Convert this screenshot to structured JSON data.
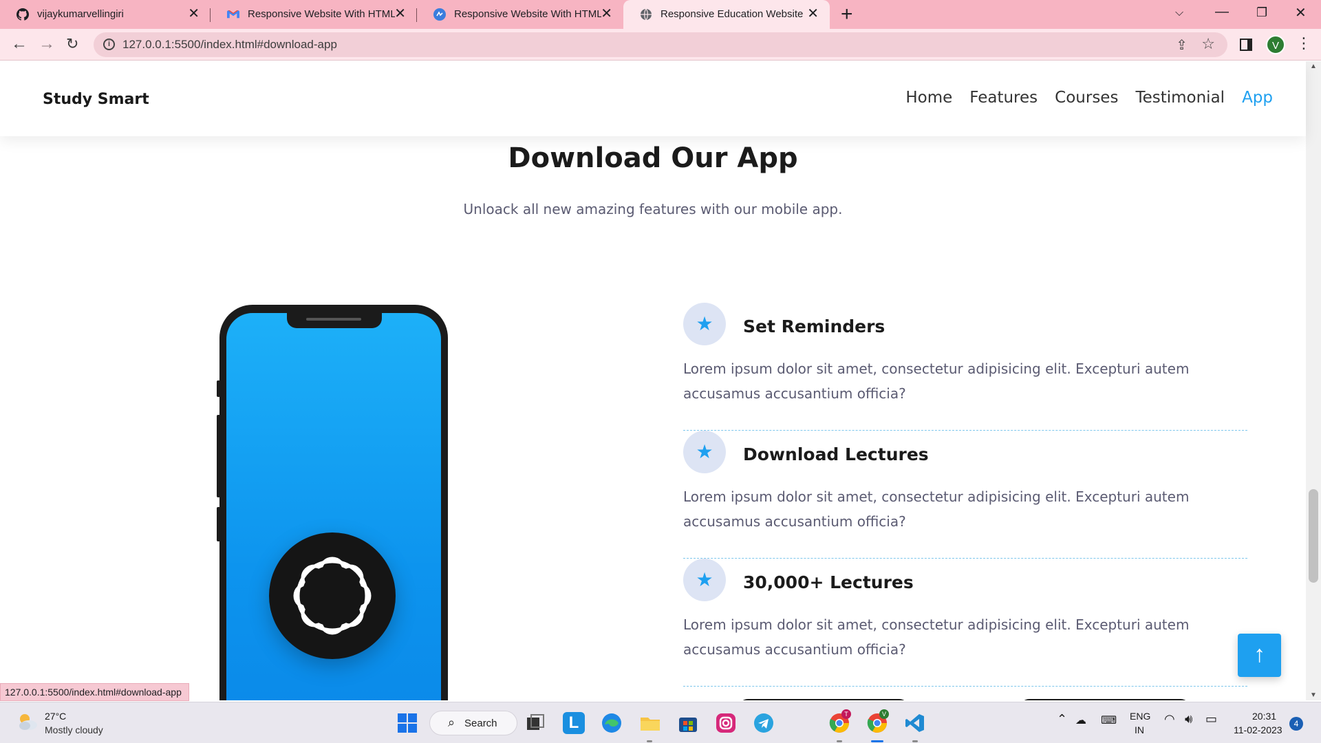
{
  "browser": {
    "tabs": [
      {
        "title": "vijaykumarvellingiri",
        "icon": "github-icon"
      },
      {
        "title": "Responsive Website With HTML,",
        "icon": "gmail-icon"
      },
      {
        "title": "Responsive Website With HTML,",
        "icon": "app-icon"
      },
      {
        "title": "Responsive Education Website",
        "icon": "globe-icon"
      }
    ],
    "new_tab": "+",
    "address": "127.0.0.1:5500/index.html#download-app",
    "profile_initial": "V",
    "status_url": "127.0.0.1:5500/index.html#download-app"
  },
  "site": {
    "logo": "Study Smart",
    "nav": [
      "Home",
      "Features",
      "Courses",
      "Testimonial",
      "App"
    ],
    "active_nav": "App",
    "accent": "#1ea0f0"
  },
  "section": {
    "title": "Download Our App",
    "subtitle": "Unloack all new amazing features with our mobile app."
  },
  "features": [
    {
      "title": "Set Reminders",
      "text": "Lorem ipsum dolor sit amet, consectetur adipisicing elit. Excepturi autem accusamus accusantium officia?",
      "icon": "star-icon"
    },
    {
      "title": "Download Lectures",
      "text": "Lorem ipsum dolor sit amet, consectetur adipisicing elit. Excepturi autem accusamus accusantium officia?",
      "icon": "star-icon"
    },
    {
      "title": "30,000+ Lectures",
      "text": "Lorem ipsum dolor sit amet, consectetur adipisicing elit. Excepturi autem accusamus accusantium officia?",
      "icon": "star-icon"
    }
  ],
  "taskbar": {
    "weather_temp": "27°C",
    "weather_desc": "Mostly cloudy",
    "search_label": "Search",
    "lang_top": "ENG",
    "lang_bottom": "IN",
    "time": "20:31",
    "date": "11-02-2023",
    "notifications": "4",
    "badge_t": "T",
    "badge_v": "V"
  }
}
